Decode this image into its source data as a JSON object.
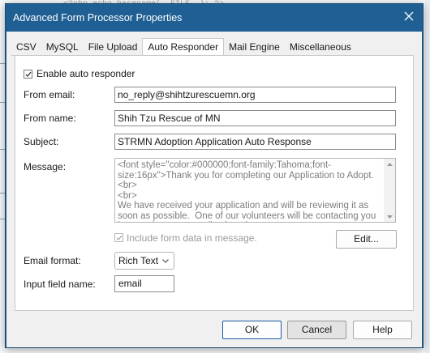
{
  "background": {
    "snippet": "<?php echo basename(__FILE__); ?>"
  },
  "dialog": {
    "title": "Advanced Form Processor Properties",
    "close_icon": "close-icon"
  },
  "tabs": [
    {
      "label": "CSV",
      "active": false
    },
    {
      "label": "MySQL",
      "active": false
    },
    {
      "label": "File Upload",
      "active": false
    },
    {
      "label": "Auto Responder",
      "active": true
    },
    {
      "label": "Mail Engine",
      "active": false
    },
    {
      "label": "Miscellaneous",
      "active": false
    }
  ],
  "form": {
    "enable_auto_responder": {
      "label": "Enable auto responder",
      "checked": true
    },
    "from_email": {
      "label": "From email:",
      "value": "no_reply@shihtzurescuemn.org"
    },
    "from_name": {
      "label": "From name:",
      "value": "Shih Tzu Rescue of MN"
    },
    "subject": {
      "label": "Subject:",
      "value": "STRMN Adoption Application Auto Response"
    },
    "message": {
      "label": "Message:",
      "value": "<font style=\"color:#000000;font-family:Tahoma;font-size:16px\">Thank you for completing our Application to Adopt.<br>\n<br>\nWe have received your application and will be reviewing it as soon as possible.  One of our volunteers will be contacting you in regards to your application.<br>"
    },
    "include_form_data": {
      "label": "Include form data in message.",
      "checked": true,
      "disabled": true
    },
    "edit_button": "Edit...",
    "email_format": {
      "label": "Email format:",
      "value": "Rich Text"
    },
    "input_field_name": {
      "label": "Input field name:",
      "value": "email"
    }
  },
  "buttons": {
    "ok": "OK",
    "cancel": "Cancel",
    "help": "Help"
  },
  "colors": {
    "titlebar": "#1f5f93",
    "dialog_bg": "#f0f0f0",
    "focus_border": "#1a5aa8"
  }
}
